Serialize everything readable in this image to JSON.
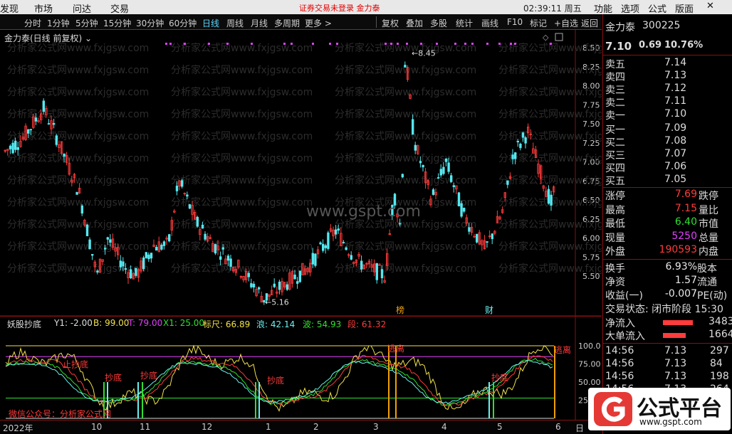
{
  "menubar": {
    "items": [
      "发现",
      "市场",
      "问达",
      "交易"
    ],
    "notice": "证券交易未登录  金力泰",
    "clock": "02:39:11 周五",
    "right_items": [
      "功能",
      "选项",
      "公式",
      "版面"
    ]
  },
  "tabs": [
    "分时",
    "1分钟",
    "5分钟",
    "15分钟",
    "30分钟",
    "60分钟",
    "日线",
    "周线",
    "月线",
    "多周期",
    "更多 >"
  ],
  "active_tab": "日线",
  "toolbar": [
    "复权",
    "叠加",
    "多股",
    "统计",
    "画线",
    "F10",
    "标记",
    "+自选",
    "返回"
  ],
  "chart_title": "金力泰(日线 前复权)",
  "price_axis": [
    "8.50",
    "8.25",
    "8.00",
    "7.75",
    "7.50",
    "7.25",
    "7.00",
    "6.75",
    "6.50",
    "6.25",
    "6.00",
    "5.75",
    "5.50"
  ],
  "annotations": {
    "high": "8.45",
    "low": "5.16",
    "tag1": "榜",
    "tag2": "财"
  },
  "watermark_url": "www.gspt.com",
  "watermark_text": "分析家公式网www.fxjgsw.com",
  "indicator": {
    "name": "妖股抄底",
    "y1": "Y1: -2.00",
    "b": "B: 99.00",
    "t": "T: 79.00",
    "x1": "X1: 25.00",
    "biaochi": "标尺: 66.89",
    "lang": "浪: 42.14",
    "bo": "波: 54.93",
    "duan": "段: 61.32"
  },
  "ind_axis": [
    "100.0",
    "75.00",
    "50.00",
    "25.00"
  ],
  "ind_labels": [
    "止抄底",
    "抄底",
    "抄底",
    "抄底",
    "抄底",
    "逃离",
    "逃离"
  ],
  "ind_footer": "微信公众号：分析家公式网",
  "time_axis": [
    "2022年",
    "10",
    "11",
    "12",
    "1",
    "2",
    "3",
    "4",
    "5",
    "6",
    "日"
  ],
  "stock": {
    "name": "金力泰",
    "code": "300225",
    "price": "7.10",
    "change": "0.69",
    "pct": "10.76%"
  },
  "sell": [
    [
      "卖五",
      "7.14"
    ],
    [
      "卖四",
      "7.13"
    ],
    [
      "卖三",
      "7.12"
    ],
    [
      "卖二",
      "7.11"
    ],
    [
      "卖一",
      "7.10"
    ]
  ],
  "buy": [
    [
      "买一",
      "7.09"
    ],
    [
      "买二",
      "7.08"
    ],
    [
      "买三",
      "7.07"
    ],
    [
      "买四",
      "7.06"
    ],
    [
      "买五",
      "7.05"
    ]
  ],
  "stats": [
    [
      "涨停",
      "7.69",
      "跌停"
    ],
    [
      "最高",
      "7.15",
      "量比"
    ],
    [
      "最低",
      "6.40",
      "市值"
    ],
    [
      "现量",
      "5250",
      "总量"
    ],
    [
      "外盘",
      "190593",
      "内盘"
    ]
  ],
  "stats2": [
    [
      "换手",
      "6.93%",
      "股本"
    ],
    [
      "净资",
      "1.57",
      "流通"
    ],
    [
      "收益(一)",
      "-0.007",
      "PE(动)"
    ]
  ],
  "status": "交易状态: 闭市阶段 15:30",
  "flows": [
    [
      "净流入",
      "3483"
    ],
    [
      "大单流入",
      "1664"
    ]
  ],
  "ticks": [
    [
      "14:56",
      "7.13",
      "297"
    ],
    [
      "14:56",
      "7.13",
      "84"
    ],
    [
      "14:56",
      "7.13",
      "198"
    ],
    [
      "14:56",
      "7.13",
      "264"
    ]
  ],
  "logo": {
    "text": "公式平台",
    "url": "www.gspt.com"
  }
}
